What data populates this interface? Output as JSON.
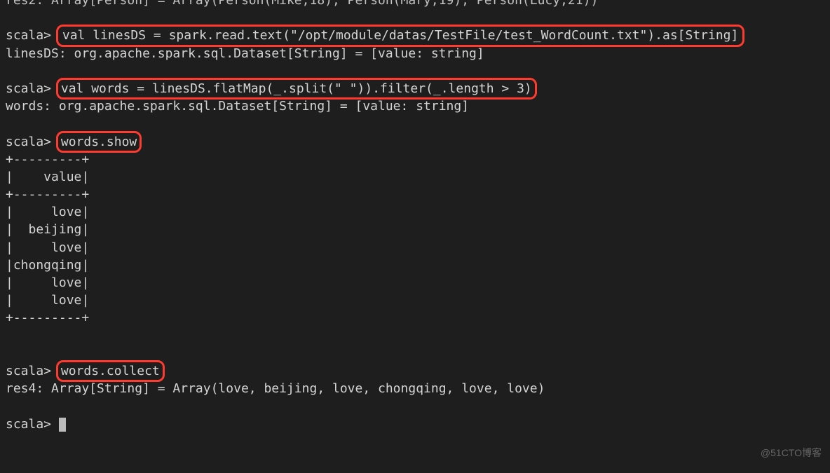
{
  "partialTop": "res2: Array[Person] = Array(Person(Mike,18), Person(Mary,19), Person(Lucy,21))",
  "prompt": "scala>",
  "cmd1": "val linesDS = spark.read.text(\"/opt/module/datas/TestFile/test_WordCount.txt\").as[String]",
  "out1": "linesDS: org.apache.spark.sql.Dataset[String] = [value: string]",
  "cmd2": "val words = linesDS.flatMap(_.split(\" \")).filter(_.length > 3)",
  "out2": "words: org.apache.spark.sql.Dataset[String] = [value: string]",
  "cmd3": "words.show",
  "table": {
    "border": "+---------+",
    "header": "|    value|",
    "rows": [
      "|     love|",
      "|  beijing|",
      "|     love|",
      "|chongqing|",
      "|     love|",
      "|     love|"
    ]
  },
  "cmd4": "words.collect",
  "out4": "res4: Array[String] = Array(love, beijing, love, chongqing, love, love)",
  "watermark": "@51CTO博客"
}
